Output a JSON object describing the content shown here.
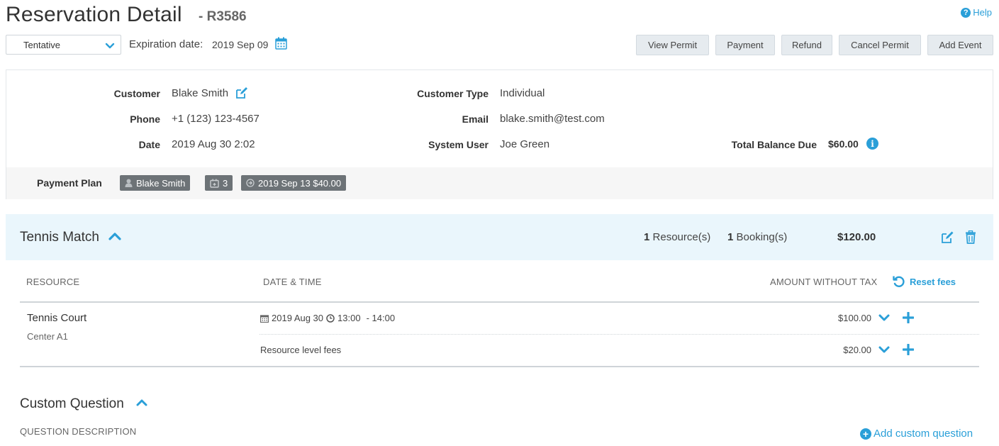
{
  "header": {
    "title": "Reservation Detail",
    "reservation_id": "- R3586",
    "help_label": "Help"
  },
  "status": {
    "selected": "Tentative"
  },
  "expiration": {
    "label": "Expiration date:",
    "value": "2019 Sep 09"
  },
  "toolbar": {
    "buttons": [
      "View Permit",
      "Payment",
      "Refund",
      "Cancel Permit",
      "Add Event"
    ]
  },
  "info": {
    "customer_label": "Customer",
    "customer_value": "Blake Smith",
    "phone_label": "Phone",
    "phone_value": "+1 (123) 123-4567",
    "date_label": "Date",
    "date_value": "2019 Aug 30 2:02",
    "customer_type_label": "Customer Type",
    "customer_type_value": "Individual",
    "email_label": "Email",
    "email_value": "blake.smith@test.com",
    "system_user_label": "System User",
    "system_user_value": "Joe Green",
    "balance_label": "Total Balance Due",
    "balance_value": "$60.00"
  },
  "payment_plan": {
    "label": "Payment Plan",
    "tags": {
      "payer": "Blake Smith",
      "count": "3",
      "next_due": "2019 Sep 13 $40.00"
    }
  },
  "event": {
    "title": "Tennis Match",
    "resource_count": "1",
    "resource_label": "Resource(s)",
    "booking_count": "1",
    "booking_label": "Booking(s)",
    "total": "$120.00",
    "columns": {
      "resource": "RESOURCE",
      "datetime": "DATE & TIME",
      "amount": "AMOUNT WITHOUT TAX"
    },
    "reset_fees_label": "Reset fees",
    "row": {
      "resource_name": "Tennis Court",
      "resource_sub": "Center A1",
      "date": "2019 Aug 30",
      "start_time": "13:00",
      "end_time": "-  14:00",
      "amount": "$100.00",
      "fee_label": "Resource level fees",
      "fee_amount": "$20.00"
    }
  },
  "custom_question": {
    "title": "Custom Question",
    "column": "QUESTION DESCRIPTION",
    "add_label": "Add custom question"
  },
  "colors": {
    "accent": "#2a9fd8",
    "event_bar": "#eaf6fc",
    "tag_bg": "#6d7377",
    "button_bg": "#e6ebef"
  }
}
